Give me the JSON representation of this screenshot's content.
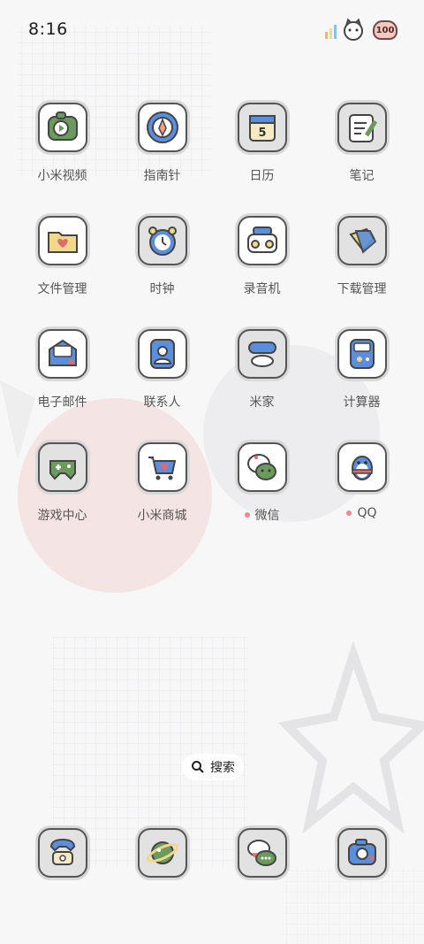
{
  "status_bar": {
    "time": "8:16",
    "battery_level": "100"
  },
  "apps": [
    {
      "label": "小米视频",
      "icon": "video-icon",
      "dot": false
    },
    {
      "label": "指南针",
      "icon": "compass-icon",
      "dot": false
    },
    {
      "label": "日历",
      "icon": "calendar-icon",
      "dot": false
    },
    {
      "label": "笔记",
      "icon": "notes-icon",
      "dot": false
    },
    {
      "label": "文件管理",
      "icon": "folder-icon",
      "dot": false
    },
    {
      "label": "时钟",
      "icon": "clock-icon",
      "dot": false
    },
    {
      "label": "录音机",
      "icon": "recorder-icon",
      "dot": false
    },
    {
      "label": "下载管理",
      "icon": "download-icon",
      "dot": false
    },
    {
      "label": "电子邮件",
      "icon": "email-icon",
      "dot": false
    },
    {
      "label": "联系人",
      "icon": "contacts-icon",
      "dot": false
    },
    {
      "label": "米家",
      "icon": "mijia-icon",
      "dot": false
    },
    {
      "label": "计算器",
      "icon": "calculator-icon",
      "dot": false
    },
    {
      "label": "游戏中心",
      "icon": "gamepad-icon",
      "dot": false
    },
    {
      "label": "小米商城",
      "icon": "cart-icon",
      "dot": false
    },
    {
      "label": "微信",
      "icon": "wechat-icon",
      "dot": true
    },
    {
      "label": "QQ",
      "icon": "penguin-icon",
      "dot": true
    }
  ],
  "calendar_day": "5",
  "search": {
    "label": "搜索"
  },
  "dock": [
    {
      "icon": "phone-icon"
    },
    {
      "icon": "planet-icon"
    },
    {
      "icon": "messages-icon"
    },
    {
      "icon": "camera-icon"
    }
  ],
  "colors": {
    "accent_blue": "#5b8fdc",
    "accent_green": "#6a9a5c",
    "accent_yellow": "#f2d98a",
    "accent_pink": "#e46a6a",
    "outline": "#555555"
  }
}
